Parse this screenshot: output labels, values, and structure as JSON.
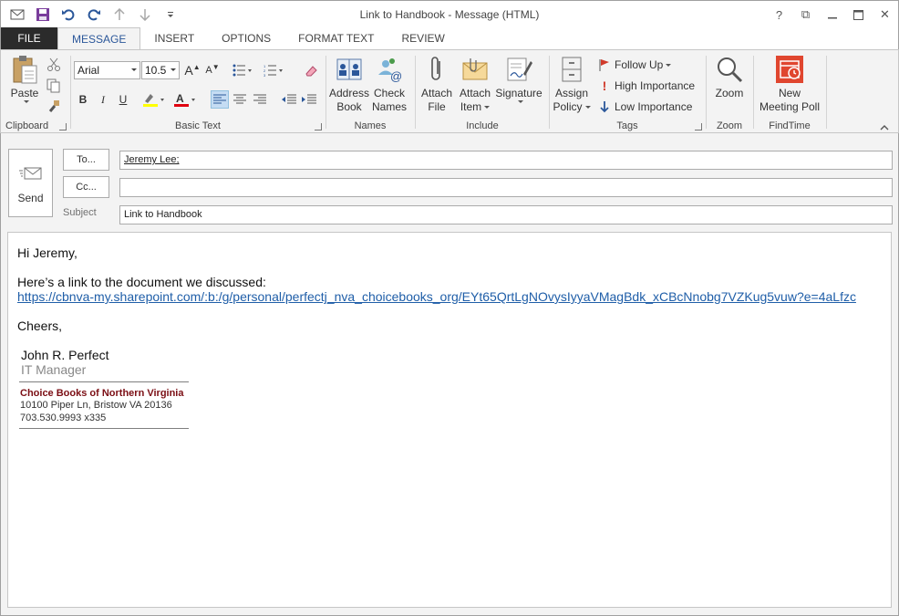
{
  "window": {
    "title": "Link to Handbook - Message (HTML)",
    "controls": {
      "help": "?",
      "restore": "⧉",
      "maximize": "☐",
      "close": "✕"
    }
  },
  "tabs": [
    {
      "label": "FILE"
    },
    {
      "label": "MESSAGE"
    },
    {
      "label": "INSERT"
    },
    {
      "label": "OPTIONS"
    },
    {
      "label": "FORMAT TEXT"
    },
    {
      "label": "REVIEW"
    }
  ],
  "ribbon": {
    "clipboard": {
      "paste": "Paste",
      "group": "Clipboard"
    },
    "basic_text": {
      "font": "Arial",
      "size": "10.5",
      "bold": "B",
      "italic": "I",
      "underline": "U",
      "grow": "A",
      "shrink": "A",
      "group": "Basic Text"
    },
    "names": {
      "address_book_1": "Address",
      "address_book_2": "Book",
      "check_names_1": "Check",
      "check_names_2": "Names",
      "group": "Names"
    },
    "include": {
      "attach_file_1": "Attach",
      "attach_file_2": "File",
      "attach_item_1": "Attach",
      "attach_item_2": "Item",
      "signature": "Signature",
      "group": "Include"
    },
    "tags": {
      "assign_policy_1": "Assign",
      "assign_policy_2": "Policy",
      "follow_up": "Follow Up",
      "high": "High Importance",
      "low": "Low Importance",
      "group": "Tags"
    },
    "zoom": {
      "zoom": "Zoom",
      "group": "Zoom"
    },
    "findtime": {
      "new_1": "New",
      "new_2": "Meeting Poll",
      "group": "FindTime"
    },
    "colors": {
      "accent": "#2b579a",
      "findtime": "#e0462f"
    }
  },
  "header": {
    "send": "Send",
    "to_button": "To...",
    "cc_button": "Cc...",
    "subject_label": "Subject",
    "to_value": "Jeremy Lee;",
    "cc_value": "",
    "subject_value": "Link to Handbook"
  },
  "message": {
    "greeting": "Hi Jeremy,",
    "intro": "Here’s a link to the document we discussed:",
    "link": "https://cbnva-my.sharepoint.com/:b:/g/personal/perfectj_nva_choicebooks_org/EYt65QrtLgNOvysIyyaVMagBdk_xCBcNnobg7VZKug5vuw?e=4aLfzc",
    "closing": "Cheers,",
    "signature": {
      "name": "John R. Perfect",
      "title": "IT Manager",
      "company": "Choice Books of Northern Virginia",
      "address": "10100 Piper Ln, Bristow VA  20136",
      "phone": "703.530.9993 x335"
    }
  }
}
